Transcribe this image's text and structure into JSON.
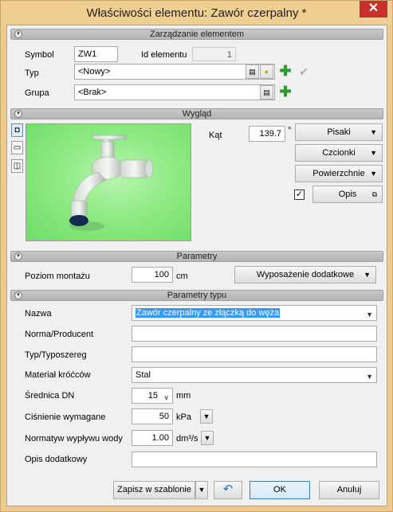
{
  "window": {
    "title": "Właściwości elementu: Zawór czerpalny *",
    "close_glyph": "✕"
  },
  "sections": {
    "management": "Zarządzanie elementem",
    "appearance": "Wygląd",
    "parameters": "Parametry",
    "type_parameters": "Parametry typu"
  },
  "management": {
    "symbol_label": "Symbol",
    "symbol_value": "ZW1",
    "id_label": "Id elementu",
    "id_value": "1",
    "type_label": "Typ",
    "type_value": "<Nowy>",
    "group_label": "Grupa",
    "group_value": "<Brak>"
  },
  "appearance": {
    "angle_label": "Kąt",
    "angle_value": "139.7",
    "angle_unit": "°",
    "pens_button": "Pisaki",
    "fonts_button": "Czcionki",
    "surfaces_button": "Powierzchnie",
    "description_checked": "✓",
    "description_button": "Opis"
  },
  "parameters": {
    "mount_level_label": "Poziom montażu",
    "mount_level_value": "100",
    "mount_level_unit": "cm",
    "extra_equipment_button": "Wyposażenie dodatkowe"
  },
  "type_parameters": {
    "name_label": "Nazwa",
    "name_value": "Zawór czerpalny ze złączką do węża",
    "norm_label": "Norma/Producent",
    "norm_value": "",
    "type_series_label": "Typ/Typoszereg",
    "type_series_value": "",
    "material_label": "Materiał króćców",
    "material_value": "Stal",
    "diameter_label": "Średnica DN",
    "diameter_value": "15",
    "diameter_unit": "mm",
    "pressure_label": "Ciśnienie wymagane",
    "pressure_value": "50",
    "pressure_unit": "kPa",
    "flow_label": "Normatyw wypływu wody",
    "flow_value": "1.00",
    "flow_unit": "dm³/s",
    "notes_label": "Opis dodatkowy",
    "notes_value": ""
  },
  "footer": {
    "save_template_button": "Zapisz w szablonie",
    "ok_button": "OK",
    "cancel_button": "Anuluj"
  }
}
